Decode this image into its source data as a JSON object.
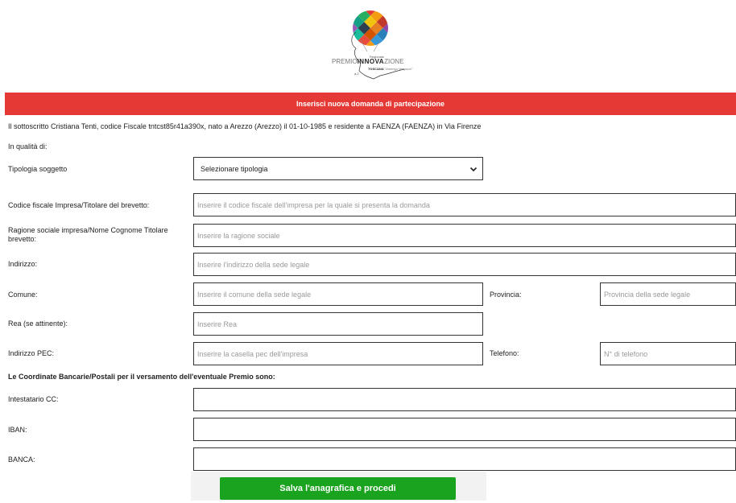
{
  "logo": {
    "line1": "Regionale",
    "premio": "PREMIO",
    "innova": "INNOVA",
    "zione": "ZIONE",
    "toscana": "TOSCANA",
    "tagline": "\"Amerigo Vespucci\"",
    "edition": "a.2"
  },
  "banner": {
    "title": "Inserisci nuova domanda di partecipazione"
  },
  "intro": "Il sottoscritto Cristiana Tenti, codice Fiscale tntcst85r41a390x, nato a Arezzo (Arezzo) il 01-10-1985 e residente a FAENZA (FAENZA) in Via Firenze",
  "form": {
    "qualita_label": "In qualità di:",
    "tipologia": {
      "label": "Tipologia soggetto",
      "selected": "Selezionare tipologia"
    },
    "codice_fiscale": {
      "label": "Codice fiscale Impresa/Titolare del brevetto:",
      "placeholder": "Inserire il codice fiscale dell'impresa per la quale si presenta la domanda",
      "value": ""
    },
    "ragione_sociale": {
      "label": "Ragione sociale impresa/Nome Cognome Titolare brevetto:",
      "placeholder": "Inserire la ragione sociale",
      "value": ""
    },
    "indirizzo": {
      "label": "Indirizzo:",
      "placeholder": "Inserire l'indirizzo della sede legale",
      "value": ""
    },
    "comune": {
      "label": "Comune:",
      "placeholder": "Inserire il comune della sede legale",
      "value": ""
    },
    "provincia": {
      "label": "Provincia:",
      "placeholder": "Provincia della sede legale",
      "value": ""
    },
    "rea": {
      "label": "Rea (se attinente):",
      "placeholder": "Inserire Rea",
      "value": ""
    },
    "pec": {
      "label": "Indirizzo PEC:",
      "placeholder": "Inserire la casella pec dell'impresa",
      "value": ""
    },
    "telefono": {
      "label": "Telefono:",
      "placeholder": "N° di telefono",
      "value": ""
    },
    "bank_section": "Le Coordinate Bancarie/Postali per il versamento dell'eventuale Premio sono:",
    "intestatario": {
      "label": "Intestatario CC:",
      "value": ""
    },
    "iban": {
      "label": "IBAN:",
      "value": ""
    },
    "banca": {
      "label": "BANCA:",
      "value": ""
    }
  },
  "submit": {
    "label": "Salva l'anagrafica e procedi"
  },
  "icons": {
    "select_arrow": "chevron-down-icon",
    "logo": "logo-balloon-icon"
  },
  "colors": {
    "banner": "#e53935",
    "button": "#1aa31e"
  }
}
